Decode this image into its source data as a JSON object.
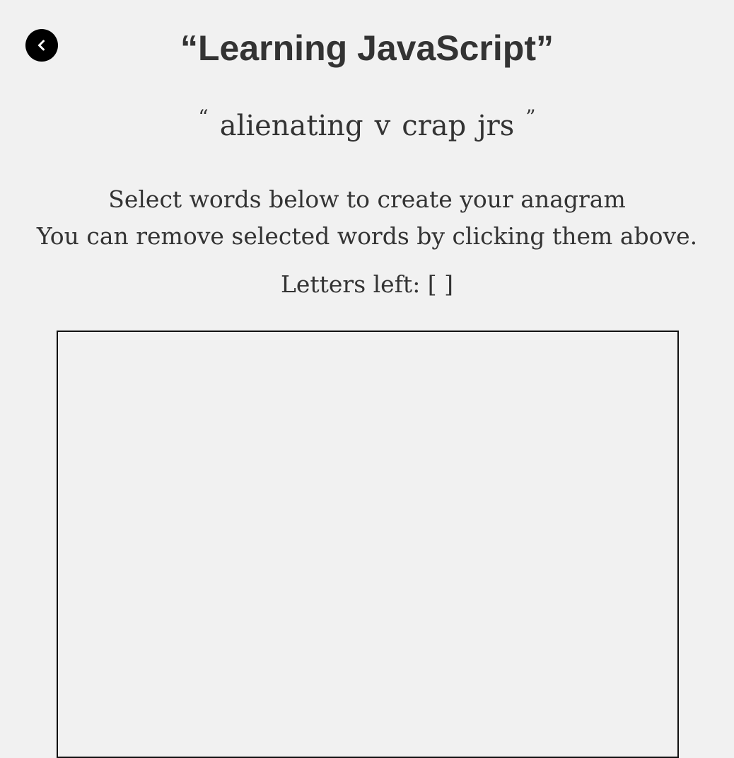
{
  "header": {
    "title": "“Learning JavaScript”",
    "back_icon": "chevron-left-icon"
  },
  "anagram": {
    "open_quote": "“",
    "close_quote": "”",
    "words": [
      "alienating",
      "v",
      "crap",
      "jrs"
    ]
  },
  "instructions": {
    "line1": "Select words below to create your anagram",
    "line2": "You can remove selected words by clicking them above."
  },
  "letters_left": {
    "label": "Letters left: [ ]"
  },
  "colors": {
    "background": "#f1f1f1",
    "text": "#333333",
    "back_button": "#000000",
    "box_border": "#111111"
  }
}
